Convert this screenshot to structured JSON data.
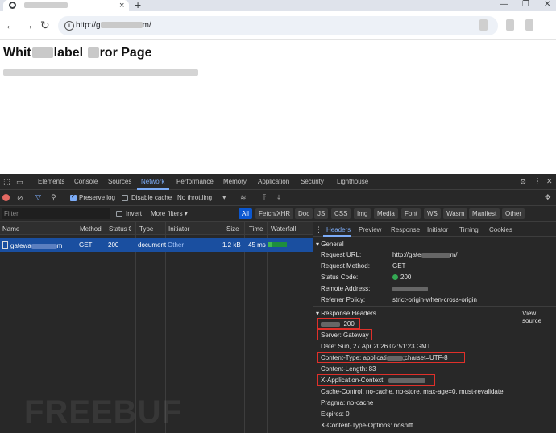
{
  "browser": {
    "tab_close": "×",
    "new_tab": "+",
    "win_min": "—",
    "win_max": "❐",
    "win_close": "✕",
    "back": "←",
    "forward": "→",
    "reload": "↻",
    "url_prefix": "http://g",
    "url_suffix": "m/"
  },
  "page": {
    "title_start": "Whit",
    "title_mid": "label",
    "title_end": "ror Page"
  },
  "devtools": {
    "tabs": [
      "Elements",
      "Console",
      "Sources",
      "Network",
      "Performance",
      "Memory",
      "Application",
      "Security",
      "Lighthouse"
    ],
    "active_tab": "Network",
    "toolbar": {
      "preserve_log": "Preserve log",
      "disable_cache": "Disable cache",
      "throttling": "No throttling"
    },
    "filter": {
      "placeholder": "Filter",
      "invert": "Invert",
      "more_filters": "More filters ▾",
      "types": [
        "All",
        "Fetch/XHR",
        "Doc",
        "JS",
        "CSS",
        "Img",
        "Media",
        "Font",
        "WS",
        "Wasm",
        "Manifest",
        "Other"
      ]
    },
    "columns": [
      "Name",
      "Method",
      "Status",
      "Type",
      "Initiator",
      "Size",
      "Time",
      "Waterfall"
    ],
    "request": {
      "name_prefix": "gatewa",
      "name_suffix": "m",
      "method": "GET",
      "status": "200",
      "type": "document",
      "initiator": "Other",
      "size": "1.2 kB",
      "time": "45 ms"
    },
    "detail_tabs": [
      "Headers",
      "Preview",
      "Response",
      "Initiator",
      "Timing",
      "Cookies"
    ],
    "general": {
      "title": "General",
      "request_url_label": "Request URL:",
      "request_url_value_prefix": "http://gate",
      "request_url_value_suffix": "m/",
      "request_method_label": "Request Method:",
      "request_method_value": "GET",
      "status_code_label": "Status Code:",
      "status_code_value": "200",
      "remote_address_label": "Remote Address:",
      "referrer_policy_label": "Referrer Policy:",
      "referrer_policy_value": "strict-origin-when-cross-origin"
    },
    "response_headers": {
      "title": "Response Headers",
      "view_source": "View source",
      "status_value": "200",
      "server": "Server:  Gateway",
      "date": "Date:  Sun, 27 Apr 2026 02:51:23 GMT",
      "content_type_prefix": "Content-Type:  applicati",
      "content_type_suffix": ";charset=UTF-8",
      "content_length": "Content-Length:  83",
      "x_app_context_label": "X-Application-Context:",
      "cache_control": "Cache-Control:  no-cache, no-store, max-age=0, must-revalidate",
      "pragma": "Pragma:  no-cache",
      "expires": "Expires:  0",
      "x_content_type_options": "X-Content-Type-Options:  nosniff"
    }
  },
  "watermark": "FREEBUF"
}
